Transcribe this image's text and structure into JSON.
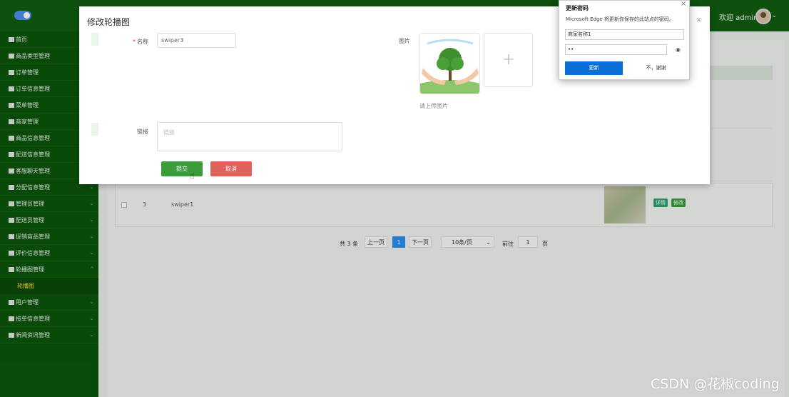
{
  "header": {
    "welcome": "欢迎 admin",
    "caret": "⌄"
  },
  "sidebar": {
    "items": [
      {
        "label": "首页",
        "caret": ""
      },
      {
        "label": "商品类型管理",
        "caret": ""
      },
      {
        "label": "订单管理",
        "caret": ""
      },
      {
        "label": "订单信息管理",
        "caret": ""
      },
      {
        "label": "菜单管理",
        "caret": ""
      },
      {
        "label": "商家管理",
        "caret": ""
      },
      {
        "label": "商品信息管理",
        "caret": ""
      },
      {
        "label": "配送信息管理",
        "caret": ""
      },
      {
        "label": "客服聊天管理",
        "caret": ""
      },
      {
        "label": "分配信息管理",
        "caret": "⌄"
      },
      {
        "label": "管理员管理",
        "caret": "⌄"
      },
      {
        "label": "配送员管理",
        "caret": "⌄"
      },
      {
        "label": "促销商品管理",
        "caret": "⌄"
      },
      {
        "label": "评价信息管理",
        "caret": "⌄"
      },
      {
        "label": "轮播图管理",
        "caret": "^"
      }
    ],
    "sub_item": "轮播图",
    "items_after": [
      {
        "label": "用户管理",
        "caret": "⌄"
      },
      {
        "label": "接单信息管理",
        "caret": "⌄"
      },
      {
        "label": "新闻资讯管理",
        "caret": "⌄"
      }
    ]
  },
  "table": {
    "row": {
      "index": "3",
      "name": "swiper1"
    },
    "detail_button": "详情",
    "edit_button": "修改"
  },
  "pagination": {
    "total": "共 3 条",
    "prev": "上一页",
    "current": "1",
    "next": "下一页",
    "page_size": "10条/页",
    "goto_label": "前往",
    "goto_value": "1",
    "page_unit": "页"
  },
  "modal": {
    "title": "修改轮播图",
    "required_mark": "*",
    "name_label": "名称",
    "name_value": "swiper3",
    "image_label": "图片",
    "upload_hint": "请上传图片",
    "link_label": "链接",
    "link_placeholder": "链接",
    "submit": "提交",
    "cancel": "取消",
    "close": "×"
  },
  "edge_popup": {
    "title": "更新密码",
    "description": "Microsoft Edge 将更新你保存的此站点的密码。",
    "username": "商家名称1",
    "password_mask": "••",
    "update": "更新",
    "dismiss": "不，谢谢",
    "close": "×",
    "eye_icon": "eye-icon"
  },
  "watermark": "CSDN @花椒coding",
  "colors": {
    "topbar": "#0f5d0f",
    "sidebar": "#0b550b",
    "submit": "#3a9d3a",
    "cancel": "#e0605a",
    "edge_blue": "#0b6fd6",
    "active_sub": "#ffd84a"
  }
}
